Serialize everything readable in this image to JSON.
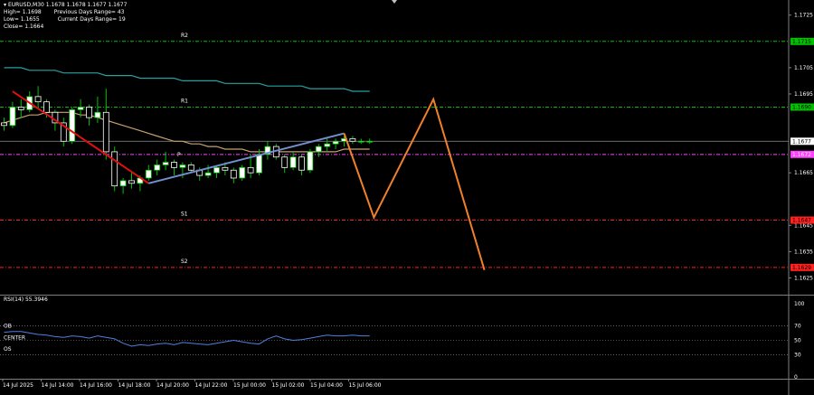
{
  "header": {
    "symbol_line": "EURUSD,M30  1.1678 1.1678 1.1677 1.1677",
    "high_line": "High= 1.1698",
    "prev_range": "Previous Days Range= 43",
    "low_line": "Low= 1.1655",
    "curr_range": "Current Days Range= 19",
    "close_line": "Close= 1.1664"
  },
  "colors": {
    "background": "#000000",
    "bull_candle": "#ffffff",
    "bear_candle": "#ffffff",
    "wick": "#00c000",
    "resistance_line": "#00c000",
    "support_line": "#ff2020",
    "pivot_line": "#ff40ff",
    "ma_slow": "#28a0a0",
    "ma_fast": "#c8a070",
    "trend_down": "#e01010",
    "trend_up": "#7090d0",
    "projection": "#f0802a",
    "rsi_line": "#5080e0",
    "grid_dotted": "#a0a0a0"
  },
  "price_axis": {
    "labels": [
      "1.1725",
      "1.1705",
      "1.1695",
      "1.1665",
      "1.1645",
      "1.1635",
      "1.1625"
    ],
    "min": 1.162,
    "max": 1.1728
  },
  "levels": [
    {
      "name": "R2",
      "price": 1.1715,
      "tag": "1.1715",
      "kind": "resistance"
    },
    {
      "name": "R1",
      "price": 1.169,
      "tag": "1.1690",
      "kind": "resistance"
    },
    {
      "name": "P",
      "price": 1.1672,
      "tag": "1.1672",
      "kind": "pivot"
    },
    {
      "name": "S1",
      "price": 1.1647,
      "tag": "1.1647",
      "kind": "support"
    },
    {
      "name": "S2",
      "price": 1.1629,
      "tag": "1.1629",
      "kind": "support"
    }
  ],
  "current_price": {
    "price": 1.1677,
    "tag": "1.1677"
  },
  "time_axis": [
    "14 Jul 2025",
    "14 Jul 14:00",
    "14 Jul 16:00",
    "14 Jul 18:00",
    "14 Jul 20:00",
    "14 Jul 22:00",
    "15 Jul 00:00",
    "15 Jul 02:00",
    "15 Jul 04:00",
    "15 Jul 06:00"
  ],
  "rsi": {
    "title": "RSI(14) 55.3946",
    "labels": [
      "100",
      "70",
      "50",
      "30",
      "0"
    ],
    "ob_label": "OB",
    "center_label": "CENTER",
    "os_label": "OS",
    "values": [
      61,
      62,
      62,
      60,
      58,
      57,
      55,
      54,
      56,
      55,
      53,
      56,
      54,
      52,
      46,
      42,
      44,
      43,
      45,
      46,
      44,
      47,
      46,
      45,
      44,
      46,
      48,
      50,
      48,
      46,
      45,
      52,
      56,
      52,
      50,
      51,
      53,
      55,
      57,
      56,
      56,
      57,
      56,
      56
    ]
  },
  "chart_data": {
    "type": "candlestick",
    "series": [
      {
        "name": "EURUSD,M30",
        "ohlc": [
          [
            1.1684,
            1.1686,
            1.1681,
            1.1683
          ],
          [
            1.1683,
            1.1692,
            1.1682,
            1.169
          ],
          [
            1.169,
            1.1693,
            1.1686,
            1.1689
          ],
          [
            1.1689,
            1.1696,
            1.1688,
            1.1694
          ],
          [
            1.1694,
            1.1698,
            1.169,
            1.1692
          ],
          [
            1.1692,
            1.1693,
            1.1686,
            1.1688
          ],
          [
            1.1688,
            1.1689,
            1.1681,
            1.1684
          ],
          [
            1.1684,
            1.1686,
            1.1675,
            1.1677
          ],
          [
            1.1677,
            1.169,
            1.1676,
            1.1689
          ],
          [
            1.1689,
            1.1693,
            1.1686,
            1.169
          ],
          [
            1.169,
            1.1691,
            1.1683,
            1.1686
          ],
          [
            1.1686,
            1.1694,
            1.1684,
            1.1688
          ],
          [
            1.1688,
            1.1697,
            1.167,
            1.1673
          ],
          [
            1.1673,
            1.1675,
            1.1658,
            1.166
          ],
          [
            1.166,
            1.1663,
            1.1657,
            1.1662
          ],
          [
            1.1662,
            1.1665,
            1.1659,
            1.1661
          ],
          [
            1.1661,
            1.1664,
            1.1658,
            1.1663
          ],
          [
            1.1663,
            1.1668,
            1.1662,
            1.1666
          ],
          [
            1.1666,
            1.167,
            1.1664,
            1.1668
          ],
          [
            1.1668,
            1.1673,
            1.1666,
            1.1669
          ],
          [
            1.1669,
            1.167,
            1.1664,
            1.1667
          ],
          [
            1.1667,
            1.1669,
            1.1663,
            1.1668
          ],
          [
            1.1668,
            1.1669,
            1.1665,
            1.1666
          ],
          [
            1.1666,
            1.1667,
            1.1662,
            1.1664
          ],
          [
            1.1664,
            1.1668,
            1.1663,
            1.1665
          ],
          [
            1.1665,
            1.1668,
            1.1663,
            1.1667
          ],
          [
            1.1667,
            1.1669,
            1.1664,
            1.1666
          ],
          [
            1.1666,
            1.1667,
            1.1661,
            1.1663
          ],
          [
            1.1663,
            1.1668,
            1.1662,
            1.1667
          ],
          [
            1.1667,
            1.1672,
            1.1663,
            1.1665
          ],
          [
            1.1665,
            1.1674,
            1.1664,
            1.1672
          ],
          [
            1.1672,
            1.1677,
            1.167,
            1.1675
          ],
          [
            1.1675,
            1.1676,
            1.167,
            1.1671
          ],
          [
            1.1671,
            1.1672,
            1.1665,
            1.1667
          ],
          [
            1.1667,
            1.1673,
            1.1666,
            1.1671
          ],
          [
            1.1671,
            1.1672,
            1.1664,
            1.1666
          ],
          [
            1.1666,
            1.1674,
            1.1665,
            1.1673
          ],
          [
            1.1673,
            1.1676,
            1.1671,
            1.1675
          ],
          [
            1.1675,
            1.1678,
            1.1673,
            1.1676
          ],
          [
            1.1676,
            1.1678,
            1.1674,
            1.1677
          ],
          [
            1.1677,
            1.1679,
            1.1675,
            1.1678
          ],
          [
            1.1678,
            1.1679,
            1.1676,
            1.1677
          ],
          [
            1.1677,
            1.1678,
            1.1676,
            1.1677
          ],
          [
            1.1677,
            1.1678,
            1.1676,
            1.1677
          ]
        ]
      },
      {
        "name": "ma_slow",
        "values": [
          1.1705,
          1.1705,
          1.1705,
          1.1704,
          1.1704,
          1.1704,
          1.1704,
          1.1703,
          1.1703,
          1.1703,
          1.1703,
          1.1703,
          1.1702,
          1.1702,
          1.1702,
          1.1702,
          1.1701,
          1.1701,
          1.1701,
          1.1701,
          1.1701,
          1.17,
          1.17,
          1.17,
          1.17,
          1.17,
          1.1699,
          1.1699,
          1.1699,
          1.1699,
          1.1699,
          1.1698,
          1.1698,
          1.1698,
          1.1698,
          1.1698,
          1.1697,
          1.1697,
          1.1697,
          1.1697,
          1.1697,
          1.1696,
          1.1696,
          1.1696
        ]
      },
      {
        "name": "ma_fast",
        "values": [
          1.1684,
          1.1685,
          1.1686,
          1.1687,
          1.1687,
          1.1688,
          1.1688,
          1.1688,
          1.1688,
          1.1687,
          1.1687,
          1.1686,
          1.1685,
          1.1684,
          1.1683,
          1.1682,
          1.1681,
          1.168,
          1.1679,
          1.1678,
          1.1677,
          1.1677,
          1.1676,
          1.1676,
          1.1675,
          1.1675,
          1.1674,
          1.1674,
          1.1674,
          1.1673,
          1.1673,
          1.1673,
          1.1673,
          1.1673,
          1.1673,
          1.1673,
          1.1673,
          1.1673,
          1.1673,
          1.1673,
          1.1674,
          1.1674,
          1.1674,
          1.1674
        ]
      }
    ],
    "trendlines": [
      {
        "name": "down",
        "from": [
          1,
          1.1696
        ],
        "to": [
          17,
          1.1661
        ]
      },
      {
        "name": "up",
        "from": [
          17,
          1.1661
        ],
        "to": [
          40,
          1.168
        ]
      }
    ],
    "projection": [
      [
        40,
        1.168
      ],
      [
        43.5,
        1.1648
      ],
      [
        50.5,
        1.1693
      ],
      [
        56.5,
        1.1628
      ]
    ]
  }
}
